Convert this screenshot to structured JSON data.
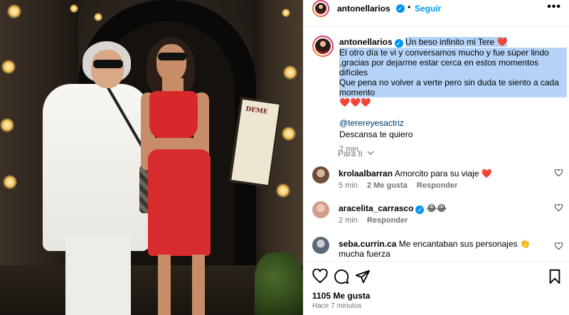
{
  "post": {
    "username": "antonellarios",
    "follow_label": "Seguir",
    "separator": "•",
    "more_label": "•••"
  },
  "caption": {
    "username": "antonellarios",
    "line1": "Un beso infinito mi Tere ❤️",
    "line2": "El otro día te vi y conversamos mucho y fue súper lindo ,gracias por dejarme estar cerca en estos momentos difíciles",
    "line3": "Que pena no volver a verte pero sin duda te siento a cada momento",
    "hearts": "❤️❤️❤️",
    "mention": "@terereyesactriz",
    "farewell": "Descansa te quiero",
    "time": "7 min"
  },
  "for_you": "Para ti",
  "comments": [
    {
      "username": "krolaalbarran",
      "text": "Amorcito para su viaje ❤️",
      "time": "5 min",
      "likes": "2 Me gusta",
      "reply": "Responder"
    },
    {
      "username": "aracelita_carrasco",
      "text": "😂😂",
      "time": "2 min",
      "reply": "Responder"
    },
    {
      "username": "seba.currin.ca",
      "text": "Me encantaban sus personajes 👏 mucha fuerza"
    }
  ],
  "footer": {
    "likes": "1105 Me gusta",
    "ago": "Hace 7 minutos"
  },
  "photo": {
    "sign_text": "DEME"
  },
  "icons": {
    "like": "heart-icon",
    "comment": "comment-icon",
    "share": "share-icon",
    "save": "bookmark-icon",
    "verified": "verified-badge-icon",
    "more": "more-options-icon"
  },
  "colors": {
    "accent_blue": "#0095f6",
    "text_secondary": "#737373",
    "selection": "#b4d3f7",
    "mention": "#00376b"
  }
}
